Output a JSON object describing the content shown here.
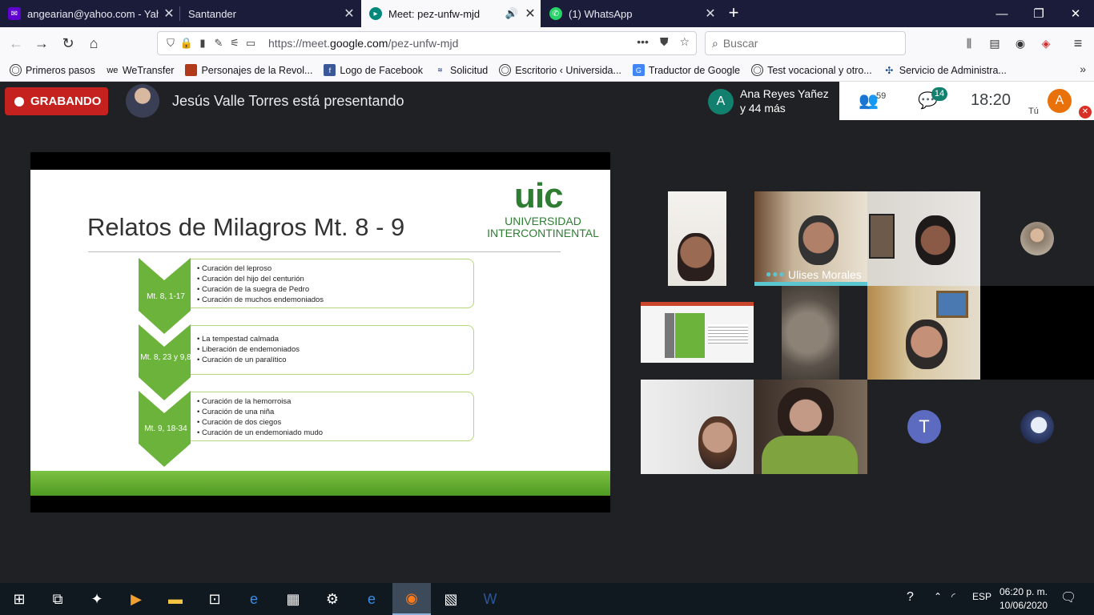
{
  "browser": {
    "tabs": [
      {
        "label": "angearian@yahoo.com - Yahoo",
        "icon": "yahoo-mail-icon"
      },
      {
        "label": "Santander",
        "icon": "none"
      },
      {
        "label": "Meet: pez-unfw-mjd",
        "icon": "google-meet-icon",
        "active": true
      },
      {
        "label": "(1) WhatsApp",
        "icon": "whatsapp-icon"
      }
    ],
    "url_prefix": "https://meet.",
    "url_domain": "google.com",
    "url_path": "/pez-unfw-mjd",
    "search_placeholder": "Buscar",
    "bookmarks": [
      {
        "label": "Primeros pasos",
        "icon": "globe-icon"
      },
      {
        "label": "WeTransfer",
        "icon": "wetransfer-icon"
      },
      {
        "label": "Personajes de la Revol...",
        "icon": "bookmark-icon"
      },
      {
        "label": "Logo de Facebook",
        "icon": "facebook-icon"
      },
      {
        "label": "Solicitud",
        "icon": "form-icon"
      },
      {
        "label": "Escritorio ‹ Universida...",
        "icon": "globe-icon"
      },
      {
        "label": "Traductor de Google",
        "icon": "translate-icon"
      },
      {
        "label": "Test vocacional y otro...",
        "icon": "globe-icon"
      },
      {
        "label": "Servicio de Administra...",
        "icon": "sat-icon"
      }
    ]
  },
  "meet": {
    "recording_label": "GRABANDO",
    "presenter_text": "Jesús Valle Torres está presentando",
    "people_avatar_letter": "A",
    "people_line1": "Ana Reyes Yañez",
    "people_line2": "y 44 más",
    "participants_count": "59",
    "chat_count": "14",
    "clock": "18:20",
    "self_label": "Tú",
    "self_avatar_letter": "A",
    "tile_active_name": "Ulises Morales",
    "tile_avatar_letter": "T"
  },
  "slide": {
    "title": "Relatos de Milagros Mt. 8 - 9",
    "logo": "uic",
    "logo_name_line1": "UNIVERSIDAD",
    "logo_name_line2": "INTERCONTINENTAL",
    "groups": [
      {
        "label": "Mt. 8, 1-17",
        "items": [
          "Curación del leproso",
          "Curación del hijo del centurión",
          "Curación de la suegra de Pedro",
          "Curación de muchos endemoniados"
        ]
      },
      {
        "label": "Mt. 8, 23 y 9,8",
        "items": [
          "La tempestad calmada",
          "Liberación de endemoniados",
          "Curación de un paralítico"
        ]
      },
      {
        "label": "Mt. 9, 18-34",
        "items": [
          "Curación de la hemorroisa",
          "Curación de una niña",
          "Curación de dos ciegos",
          "Curación de un endemoniado mudo"
        ]
      }
    ],
    "accent_color": "#6bb33a"
  },
  "taskbar": {
    "language": "ESP",
    "time": "06:20 p. m.",
    "date": "10/06/2020"
  }
}
